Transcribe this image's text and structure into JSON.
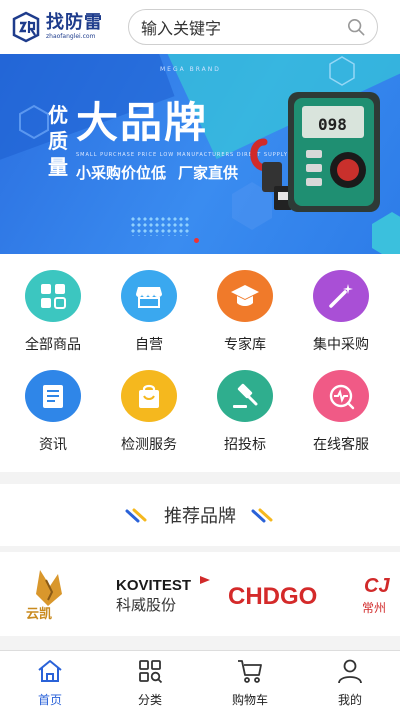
{
  "header": {
    "logo_name": "找防雷",
    "logo_domain": "zhaofanglei.com",
    "search_placeholder": "输入关键字"
  },
  "banner": {
    "small_caption": "MEGA BRAND",
    "side_text": "优质量",
    "title": "大品牌",
    "english_line": "SMALL PURCHASE PRICE LOW MANUFACTURERS DIRECT SUPPLY",
    "sub_left": "小采购价位低",
    "sub_right": "厂家直供",
    "meter_reading": "098"
  },
  "menu": [
    {
      "label": "全部商品",
      "icon": "grid-icon",
      "color": "#3cc6c0"
    },
    {
      "label": "自营",
      "icon": "storefront-icon",
      "color": "#3aa8ef"
    },
    {
      "label": "专家库",
      "icon": "graduation-cap-icon",
      "color": "#f07a2a"
    },
    {
      "label": "集中采购",
      "icon": "magic-wand-icon",
      "color": "#a94fd6"
    },
    {
      "label": "资讯",
      "icon": "document-icon",
      "color": "#2f86e8"
    },
    {
      "label": "检测服务",
      "icon": "shopping-bag-icon",
      "color": "#f5b81e"
    },
    {
      "label": "招投标",
      "icon": "gavel-icon",
      "color": "#2fae8e"
    },
    {
      "label": "在线客服",
      "icon": "support-icon",
      "color": "#f05a86"
    }
  ],
  "recommended": {
    "title": "推荐品牌"
  },
  "brands": [
    {
      "name": "云凯"
    },
    {
      "name": "KOVITEST",
      "subtitle": "科威股份"
    },
    {
      "name": "CHDGO"
    },
    {
      "name": "CJ",
      "subtitle": "常州"
    }
  ],
  "tabs": [
    {
      "label": "首页",
      "icon": "home-icon",
      "active": true
    },
    {
      "label": "分类",
      "icon": "category-icon",
      "active": false
    },
    {
      "label": "购物车",
      "icon": "cart-icon",
      "active": false
    },
    {
      "label": "我的",
      "icon": "user-icon",
      "active": false
    }
  ],
  "colors": {
    "brand_blue": "#1e3c8c",
    "active_tab": "#2a62d8"
  }
}
